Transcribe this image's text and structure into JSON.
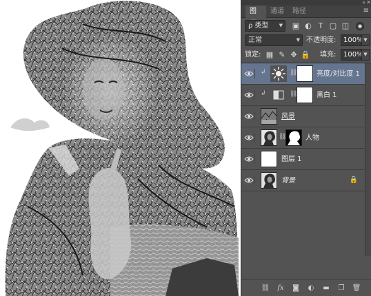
{
  "panel": {
    "tabs": [
      {
        "label": "图层",
        "active": true
      },
      {
        "label": "通道",
        "active": false
      },
      {
        "label": "路径",
        "active": false
      }
    ],
    "filter": {
      "label": "ρ 类型"
    },
    "blend_mode": "正常",
    "opacity_label": "不透明度:",
    "opacity_value": "100%",
    "lock_label": "锁定:",
    "fill_label": "填充:",
    "fill_value": "100%"
  },
  "layers": [
    {
      "name": "亮度/对比度 1",
      "kind": "adjustment",
      "selected": true,
      "clipped": true,
      "icon": "sun-icon"
    },
    {
      "name": "黑白 1",
      "kind": "adjustment",
      "selected": false,
      "clipped": true,
      "icon": "black-white-icon"
    },
    {
      "name": "风景",
      "kind": "photo",
      "selected": false,
      "clipped": false
    },
    {
      "name": "人物",
      "kind": "photo-with-mask",
      "selected": false,
      "clipped": false
    },
    {
      "name": "图层 1",
      "kind": "fill",
      "selected": false,
      "clipped": false
    },
    {
      "name": "背景",
      "kind": "background",
      "selected": false,
      "clipped": false,
      "locked": true
    }
  ],
  "bottom_icons": [
    "link-icon",
    "fx-icon",
    "mask-icon",
    "adjustment-icon",
    "group-icon",
    "new-layer-icon",
    "trash-icon"
  ],
  "colors": {
    "panel_bg": "#535353",
    "selected_bg": "#65758f",
    "field_bg": "#3a3a3a"
  }
}
